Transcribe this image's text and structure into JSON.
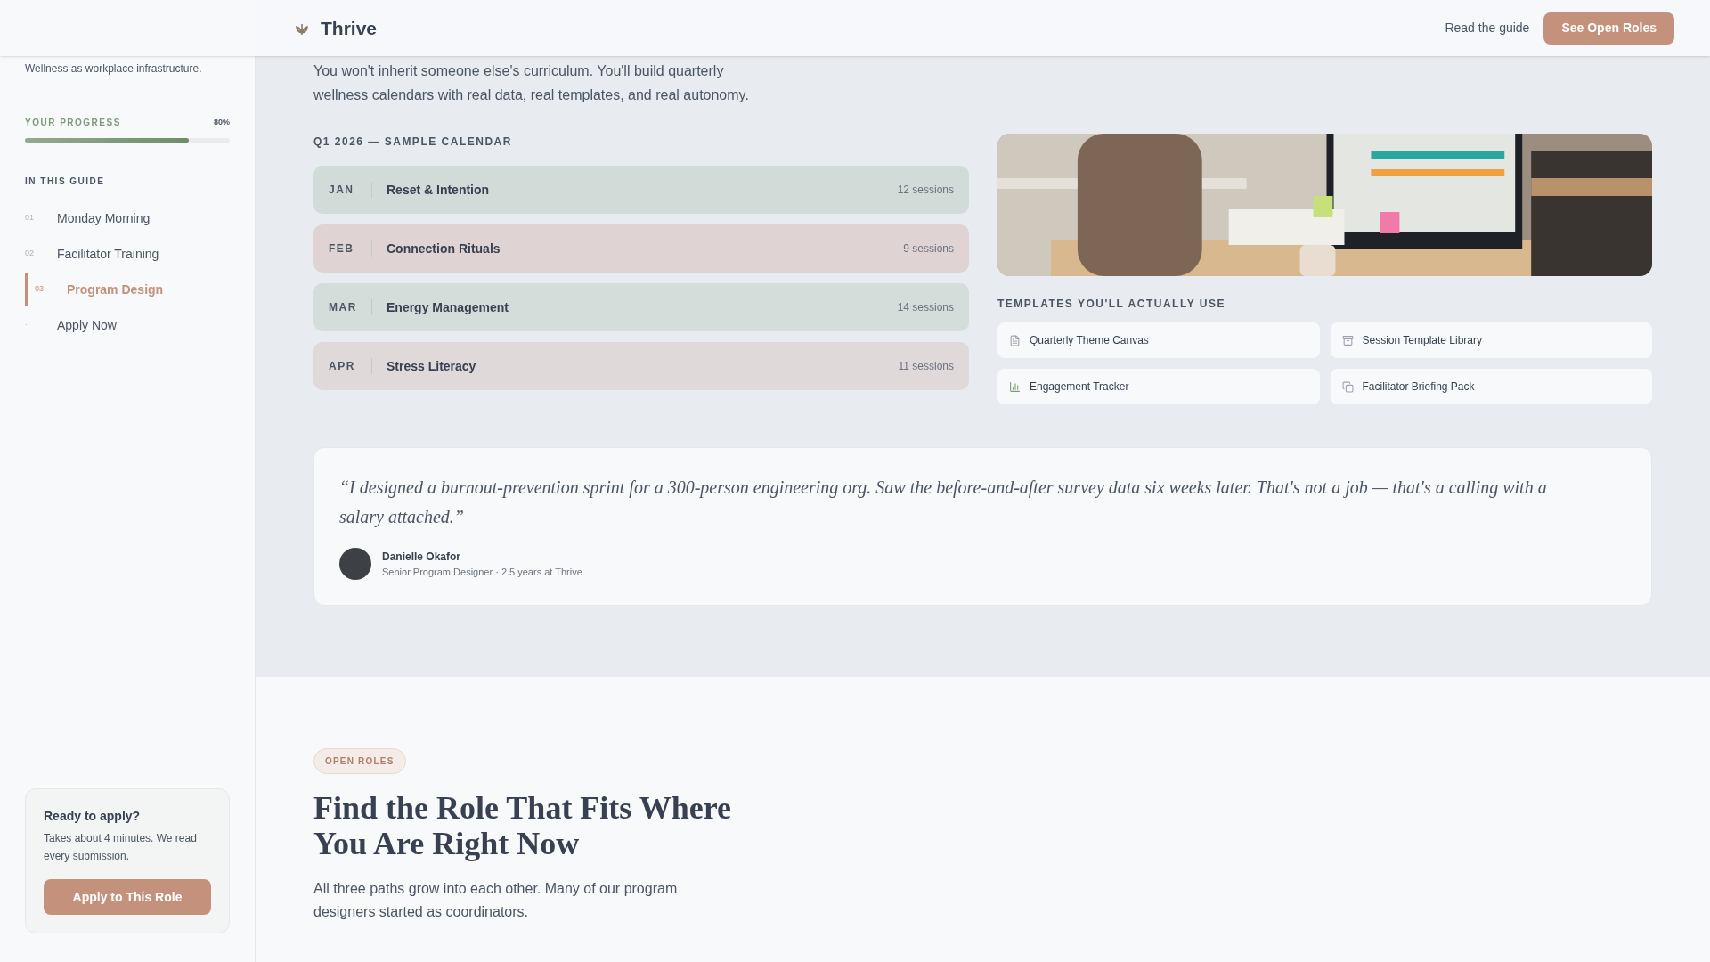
{
  "header": {
    "brand": "Thrive",
    "link": "Read the guide",
    "cta": "See Open Roles"
  },
  "sidebar": {
    "tagline": "Wellness as workplace infrastructure.",
    "progress": {
      "label": "YOUR PROGRESS",
      "reading": "80%",
      "level": 0.8
    },
    "guide_title": "IN THIS GUIDE",
    "items": [
      {
        "number": "01",
        "label": "Monday Morning",
        "selected": false
      },
      {
        "number": "02",
        "label": "Facilitator Training",
        "selected": false
      },
      {
        "number": "03",
        "label": "Program Design",
        "selected": true
      },
      {
        "number": "·",
        "label": "Apply Now",
        "selected": false
      }
    ],
    "apply_card": {
      "title": "Ready to apply?",
      "text": "Takes about 4 minutes. We read every submission.",
      "button": "Apply to This Role"
    }
  },
  "intro": "You won't inherit someone else's curriculum. You'll build quarterly wellness calendars with real data, real templates, and real autonomy.",
  "calendar": {
    "title": "Q1 2026 — SAMPLE CALENDAR",
    "rows": [
      {
        "month": "JAN",
        "theme": "Reset & Intention",
        "sessions": "12 sessions",
        "color": "#d1dbd7"
      },
      {
        "month": "FEB",
        "theme": "Connection Rituals",
        "sessions": "9 sessions",
        "color": "#dfd3d3"
      },
      {
        "month": "MAR",
        "theme": "Energy Management",
        "sessions": "14 sessions",
        "color": "#d4ddd9"
      },
      {
        "month": "APR",
        "theme": "Stress Literacy",
        "sessions": "11 sessions",
        "color": "#e0d9da"
      }
    ]
  },
  "templates": {
    "title": "TEMPLATES YOU'LL ACTUALLY USE",
    "items": [
      {
        "label": "Quarterly Theme Canvas",
        "kind": "document"
      },
      {
        "label": "Session Template Library",
        "kind": "archive"
      },
      {
        "label": "Engagement Tracker",
        "kind": "chart"
      },
      {
        "label": "Facilitator Briefing Pack",
        "kind": "copy"
      }
    ]
  },
  "testimonial": {
    "quote": "“I designed a burnout-prevention sprint for a 300-person engineering org. Saw the before-and-after survey data six weeks later. That's not a job — that's a calling with a salary attached.”",
    "name": "Danielle Okafor",
    "role": "Senior Program Designer · 2.5 years at Thrive"
  },
  "open_roles": {
    "badge": "OPEN ROLES",
    "heading": "Find the Role That Fits Where You Are Right Now",
    "text": "All three paths grow into each other. Many of our program designers started as coordinators."
  }
}
